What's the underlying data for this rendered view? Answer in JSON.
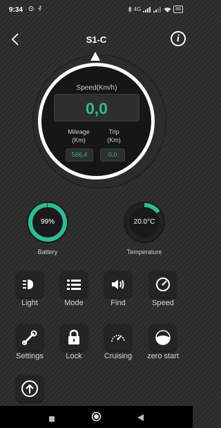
{
  "status_bar": {
    "time": "9:34",
    "left_icons": "⏰ 🏃",
    "right_text": "4G",
    "battery": "88"
  },
  "header": {
    "title": "S1-C"
  },
  "speedometer": {
    "speed_label": "Speed(Km/h)",
    "speed_value": "0,0",
    "mileage_label_line1": "Mileage",
    "mileage_label_line2": "(Km)",
    "mileage_value": "566,4",
    "trip_label_line1": "Trip",
    "trip_label_line2": "(Km)",
    "trip_value": "0,0"
  },
  "battery_dial": {
    "value": "99%",
    "label": "Battery",
    "level_percent": 99,
    "color": "#2dbb98"
  },
  "temperature_dial": {
    "value": "20.0°C",
    "label": "Temperature",
    "level_percent": 15,
    "color": "#2dbb98"
  },
  "controls": [
    {
      "label": "Light",
      "icon": "headlight-icon"
    },
    {
      "label": "Mode",
      "icon": "list-icon"
    },
    {
      "label": "Find",
      "icon": "speaker-icon"
    },
    {
      "label": "Speed",
      "icon": "gauge-icon"
    },
    {
      "label": "Settings",
      "icon": "wrench-icon"
    },
    {
      "label": "Lock",
      "icon": "lock-icon"
    },
    {
      "label": "Cruising",
      "icon": "cruise-icon"
    },
    {
      "label": "zero start",
      "icon": "half-circle-icon"
    },
    {
      "label": "",
      "icon": "upload-arrow-icon"
    }
  ],
  "colors": {
    "accent": "#2dbb98",
    "background": "#2a2a2a",
    "tile": "#242424"
  }
}
